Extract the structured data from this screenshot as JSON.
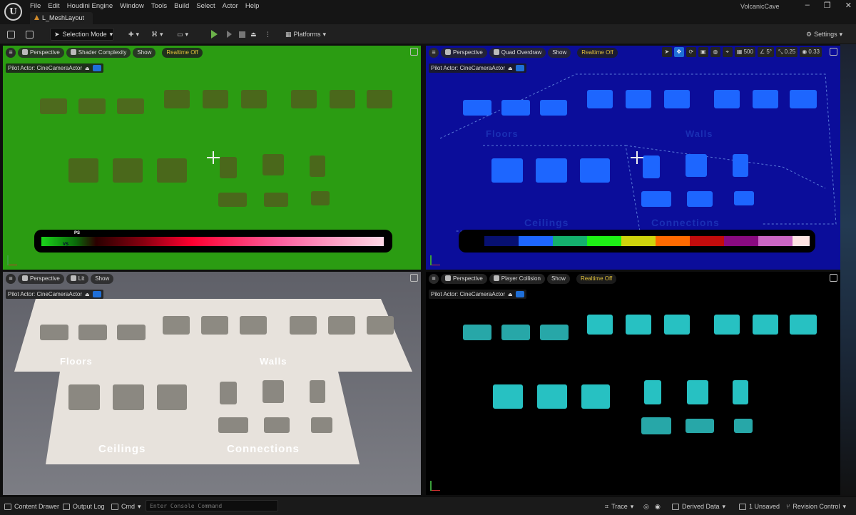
{
  "window": {
    "project_name": "VolcanicCave",
    "level_tab": "L_MeshLayout",
    "menu": [
      "File",
      "Edit",
      "Houdini Engine",
      "Window",
      "Tools",
      "Build",
      "Select",
      "Actor",
      "Help"
    ],
    "logo": "U"
  },
  "toolbar": {
    "selection_mode": "Selection Mode",
    "platforms": "Platforms",
    "settings": "Settings"
  },
  "viewports": {
    "tl": {
      "perspective": "Perspective",
      "mode": "Shader Complexity",
      "show": "Show",
      "realtime": "Realtime Off",
      "pilot": "Pilot Actor: CineCameraActor",
      "ps": "PS",
      "vs": "VS"
    },
    "tr": {
      "perspective": "Perspective",
      "mode": "Quad Overdraw",
      "show": "Show",
      "realtime": "Realtime Off",
      "pilot": "Pilot Actor: CineCameraActor",
      "grid": "500",
      "angle": "5°",
      "scale": "0.25",
      "cam_speed": "0.33",
      "labels": [
        "Floors",
        "Walls",
        "Ceilings",
        "Connections"
      ]
    },
    "bl": {
      "perspective": "Perspective",
      "mode": "Lit",
      "show": "Show",
      "pilot": "Pilot Actor: CineCameraActor",
      "labels": [
        "Floors",
        "Walls",
        "Ceilings",
        "Connections"
      ]
    },
    "br": {
      "perspective": "Perspective",
      "mode": "Player Collision",
      "show": "Show",
      "realtime": "Realtime Off",
      "pilot": "Pilot Actor: CineCameraActor"
    }
  },
  "colors": {
    "shader_complexity_bg": "#2b9c12",
    "quad_overdraw_bg": "#0b0d9a",
    "lit_bg": "#6c6d75",
    "collision_mesh": "#27c1c2"
  },
  "statusbar": {
    "content_drawer": "Content Drawer",
    "output_log": "Output Log",
    "cmd": "Cmd",
    "console_placeholder": "Enter Console Command",
    "trace": "Trace",
    "derived_data": "Derived Data",
    "unsaved": "1 Unsaved",
    "revision_control": "Revision Control"
  }
}
